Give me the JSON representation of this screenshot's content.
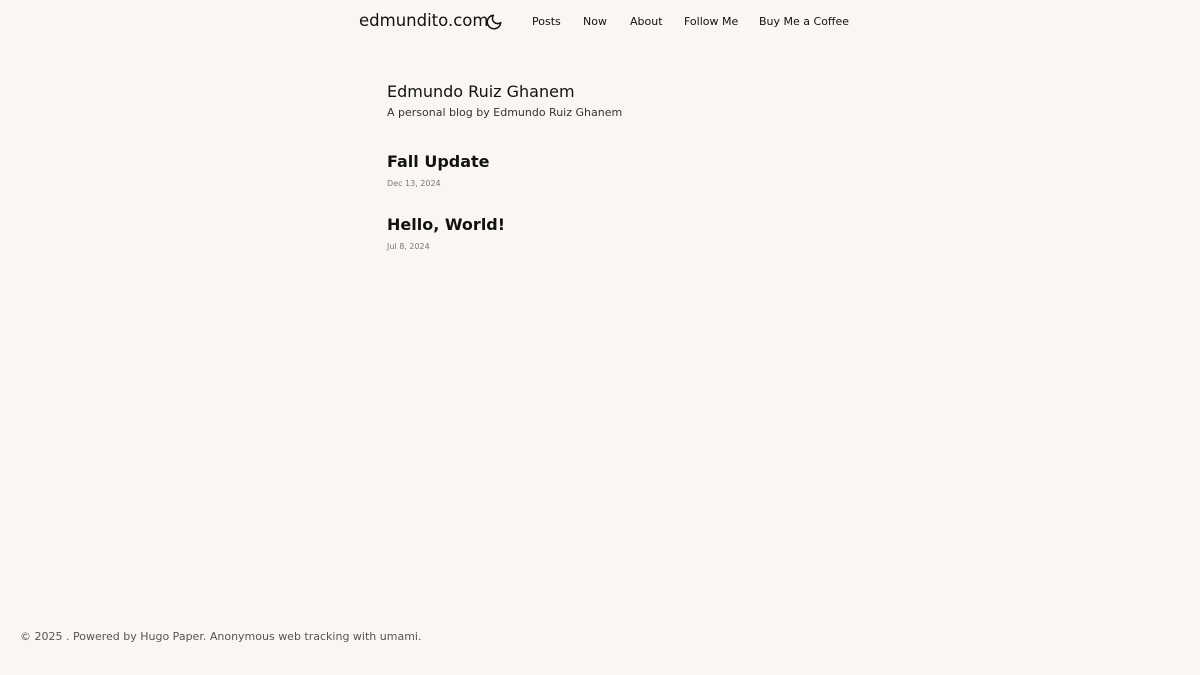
{
  "header": {
    "site_title": "edmundito.com",
    "theme_toggle_icon": "moon-icon",
    "nav": [
      {
        "label": "Posts"
      },
      {
        "label": "Now"
      },
      {
        "label": "About"
      },
      {
        "label": "Follow Me"
      },
      {
        "label": "Buy Me a Coffee"
      }
    ]
  },
  "profile": {
    "name": "Edmundo Ruiz Ghanem",
    "description": "A personal blog by Edmundo Ruiz Ghanem"
  },
  "posts": [
    {
      "title": "Fall Update",
      "date": "Dec 13, 2024"
    },
    {
      "title": "Hello, World!",
      "date": "Jul 8, 2024"
    }
  ],
  "footer": {
    "copyright": "© 2025 . Powered by ",
    "powered_by_link": "Hugo Paper",
    "separator": ". Anonymous web tracking with ",
    "tracking_link": "umami",
    "end": "."
  },
  "colors": {
    "background": "#faf7f2",
    "text": "#111111",
    "muted": "#777777"
  }
}
